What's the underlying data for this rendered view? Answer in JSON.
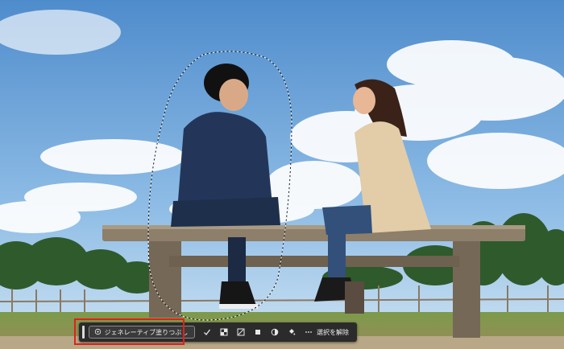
{
  "toolbar": {
    "generative_fill_label": "ジェネレーティブ塗りつぶし",
    "deselect_label": "選択を解除",
    "tools": [
      {
        "name": "checkmark-icon"
      },
      {
        "name": "mask-icon"
      },
      {
        "name": "transform-icon"
      },
      {
        "name": "square-icon"
      },
      {
        "name": "contrast-icon"
      },
      {
        "name": "bucket-icon"
      },
      {
        "name": "more-icon"
      }
    ]
  },
  "colors": {
    "highlight": "#e0201a",
    "toolbar_bg": "#2b2b2b"
  }
}
